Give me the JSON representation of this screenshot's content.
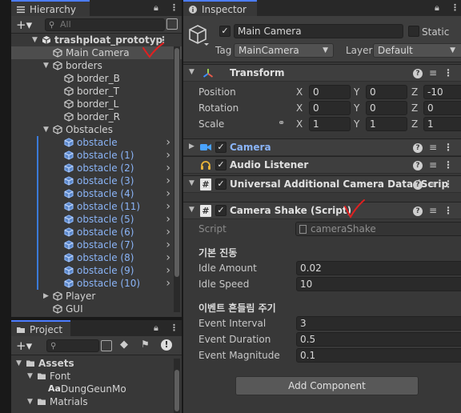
{
  "hierarchy": {
    "tab_label": "Hierarchy",
    "search_placeholder": "All",
    "items": [
      {
        "label": "trashploat_prototyp",
        "type": "scene",
        "expanded": true
      },
      {
        "label": "Main Camera",
        "type": "object",
        "selected": true
      },
      {
        "label": "borders",
        "type": "object",
        "expanded": true
      },
      {
        "label": "border_B",
        "type": "object"
      },
      {
        "label": "border_T",
        "type": "object"
      },
      {
        "label": "border_L",
        "type": "object"
      },
      {
        "label": "border_R",
        "type": "object"
      },
      {
        "label": "Obstacles",
        "type": "object",
        "expanded": true
      },
      {
        "label": "obstacle",
        "type": "prefab"
      },
      {
        "label": "obstacle (1)",
        "type": "prefab"
      },
      {
        "label": "obstacle (2)",
        "type": "prefab"
      },
      {
        "label": "obstacle (3)",
        "type": "prefab"
      },
      {
        "label": "obstacle (4)",
        "type": "prefab"
      },
      {
        "label": "obstacle (11)",
        "type": "prefab"
      },
      {
        "label": "obstacle (5)",
        "type": "prefab"
      },
      {
        "label": "obstacle (6)",
        "type": "prefab"
      },
      {
        "label": "obstacle (7)",
        "type": "prefab"
      },
      {
        "label": "obstacle (8)",
        "type": "prefab"
      },
      {
        "label": "obstacle (9)",
        "type": "prefab"
      },
      {
        "label": "obstacle (10)",
        "type": "prefab"
      },
      {
        "label": "Player",
        "type": "object",
        "collapsed": true
      },
      {
        "label": "GUI",
        "type": "object"
      }
    ]
  },
  "project": {
    "tab_label": "Project",
    "tree": [
      {
        "label": "Assets",
        "type": "folder"
      },
      {
        "label": "Font",
        "type": "folder"
      },
      {
        "label": "DungGeunMo",
        "type": "font",
        "prefix": "Aa"
      },
      {
        "label": "Matrials",
        "type": "folder"
      }
    ]
  },
  "inspector": {
    "tab_label": "Inspector",
    "object_name": "Main Camera",
    "static_label": "Static",
    "tag_label": "Tag",
    "tag_value": "MainCamera",
    "layer_label": "Layer",
    "layer_value": "Default",
    "transform": {
      "title": "Transform",
      "rows": [
        {
          "label": "Position",
          "x": "0",
          "y": "0",
          "z": "-10"
        },
        {
          "label": "Rotation",
          "x": "0",
          "y": "0",
          "z": "0"
        },
        {
          "label": "Scale",
          "x": "1",
          "y": "1",
          "z": "1"
        }
      ],
      "axis_x": "X",
      "axis_y": "Y",
      "axis_z": "Z"
    },
    "components": [
      {
        "title": "Camera",
        "enabled": true
      },
      {
        "title": "Audio Listener",
        "enabled": true
      },
      {
        "title": "Universal Additional Camera Data (Scrip",
        "enabled": true
      }
    ],
    "camera_shake": {
      "title": "Camera Shake (Script)",
      "script_label": "Script",
      "script_value": "cameraShake",
      "section1_title": "기본 진동",
      "idle_amount_label": "Idle Amount",
      "idle_amount_value": "0.02",
      "idle_speed_label": "Idle Speed",
      "idle_speed_value": "10",
      "section2_title": "이벤트 흔들림 주기",
      "event_interval_label": "Event Interval",
      "event_interval_value": "3",
      "event_duration_label": "Event Duration",
      "event_duration_value": "0.5",
      "event_magnitude_label": "Event Magnitude",
      "event_magnitude_value": "0.1"
    },
    "add_component_label": "Add Component"
  },
  "colors": {
    "accent": "#4c7dff",
    "prefab_text": "#8ab4f7",
    "annotation_red": "#e02020"
  }
}
